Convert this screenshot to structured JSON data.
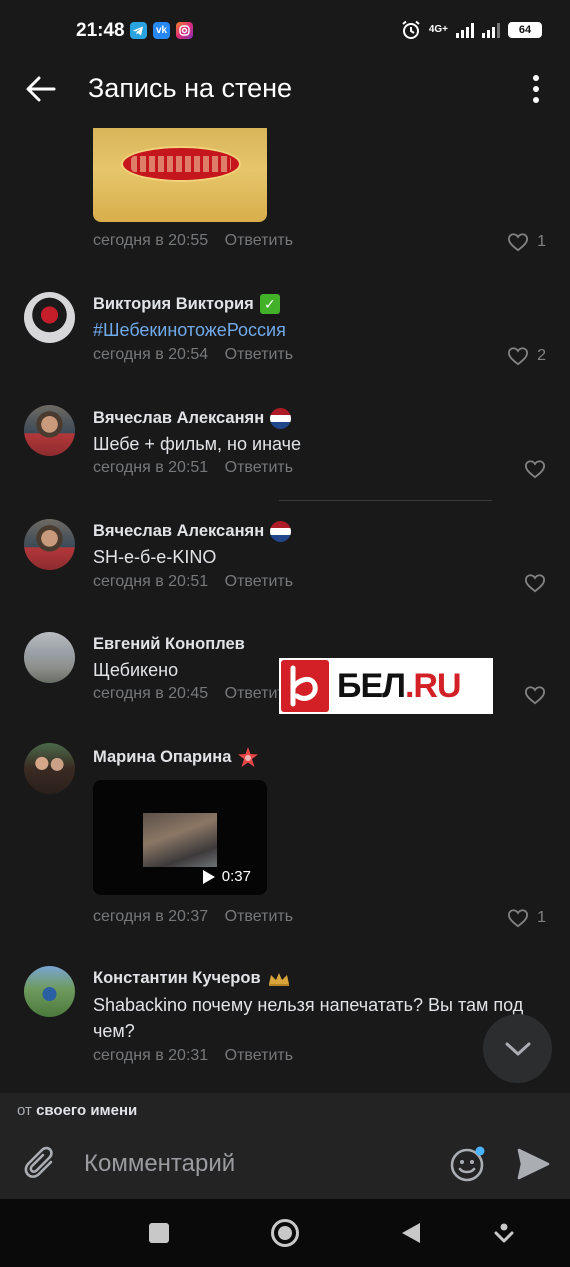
{
  "status_bar": {
    "time": "21:48",
    "apps": [
      "telegram-icon",
      "vk-icon",
      "instagram-icon"
    ],
    "app_labels": {
      "vk": "vk"
    },
    "network": "4G+",
    "battery": "64"
  },
  "header": {
    "title": "Запись на стене",
    "back_icon": "arrow-left-icon",
    "menu_icon": "more-vertical-icon"
  },
  "comments": [
    {
      "author": "",
      "attachment": "photo-pasta-package",
      "time": "сегодня в 20:55",
      "reply": "Ответить",
      "likes": "1"
    },
    {
      "author": "Виктория Виктория",
      "badge": "check-badge-icon",
      "text": "#ШебекинотожеРоссия",
      "time": "сегодня в 20:54",
      "reply": "Ответить",
      "likes": "2"
    },
    {
      "author": "Вячеслав Алексанян",
      "badge": "netherlands-flag-icon",
      "text": "Шебе + фильм, но иначе",
      "time": "сегодня в 20:51",
      "reply": "Ответить",
      "likes": ""
    },
    {
      "author": "Вячеслав Алексанян",
      "badge": "netherlands-flag-icon",
      "text": "SH-е-б-е-KINO",
      "time": "сегодня в 20:51",
      "reply": "Ответить",
      "likes": ""
    },
    {
      "author": "Евгений Коноплев",
      "text": "Щебикено",
      "time": "сегодня в 20:45",
      "reply": "Ответить",
      "likes": ""
    },
    {
      "author": "Марина Опарина",
      "badge": "star-badge-icon",
      "attachment": "video",
      "video_duration": "0:37",
      "time": "сегодня в 20:37",
      "reply": "Ответить",
      "likes": "1"
    },
    {
      "author": "Константин Кучеров",
      "badge": "crown-badge-icon",
      "text_line1": "Shabackino почему нельзя напечатать? Вы там под",
      "text_line2": "чем?",
      "time": "сегодня в 20:31",
      "reply": "Ответить",
      "likes": ""
    }
  ],
  "watermark": {
    "text_main": "БЕЛ",
    "text_accent": ".RU"
  },
  "from_bar": {
    "prefix": "от",
    "name": "своего имени"
  },
  "composer": {
    "placeholder": "Комментарий"
  },
  "colors": {
    "background": "#19191a",
    "text": "#e1e3e6",
    "secondary_text": "#76787a",
    "link": "#71aaeb",
    "composer_bg": "#232324"
  }
}
